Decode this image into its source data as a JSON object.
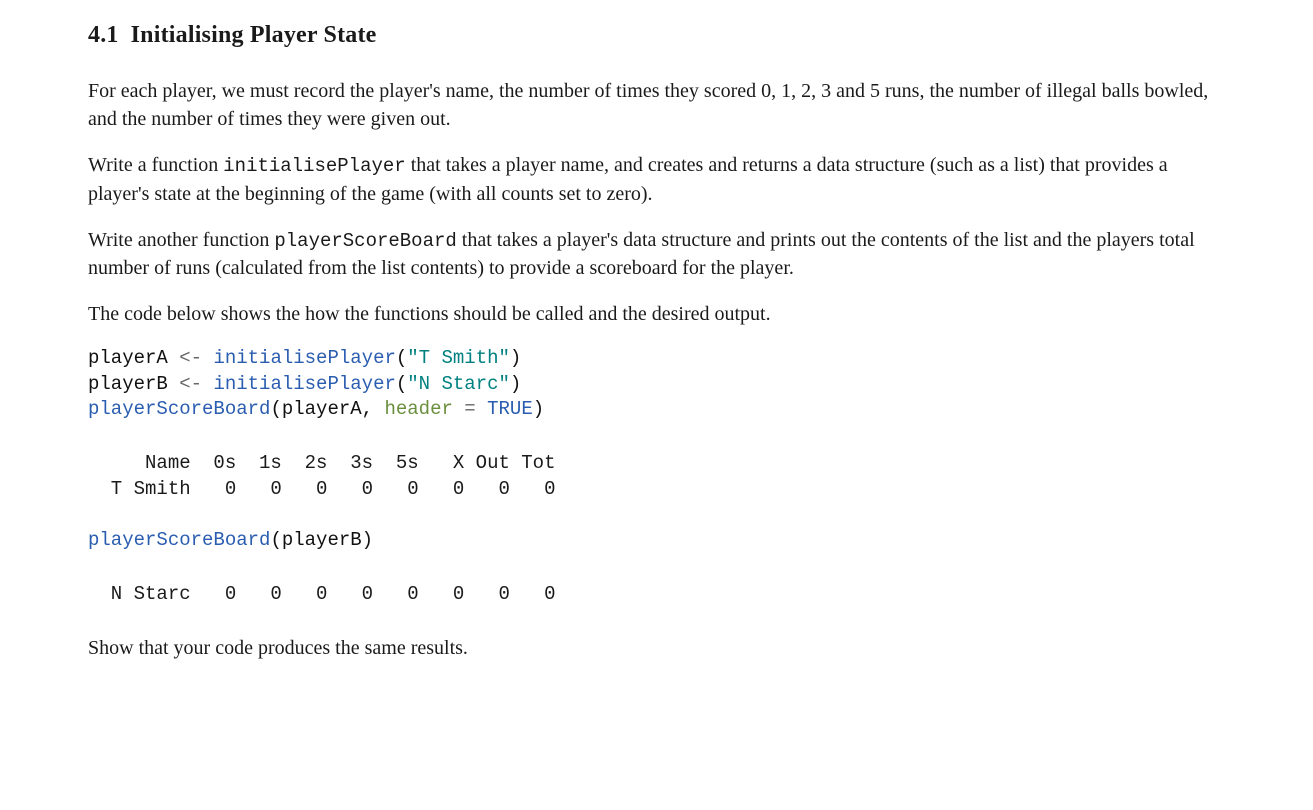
{
  "section": {
    "number": "4.1",
    "title": "Initialising Player State"
  },
  "paragraphs": {
    "p1": "For each player, we must record the player's name, the number of times they scored 0, 1, 2, 3 and 5 runs, the number of illegal balls bowled, and the number of times they were given out.",
    "p2a": "Write a function ",
    "p2_code": "initialisePlayer",
    "p2b": " that takes a player name, and creates and returns a data structure (such as a list) that provides a player's state at the beginning of the game (with all counts set to zero).",
    "p3a": "Write another function ",
    "p3_code": "playerScoreBoard",
    "p3b": " that takes a player's data structure and prints out the contents of the list and the players total number of runs (calculated from the list contents) to provide a scoreboard for the player.",
    "p4": "The code below shows the how the functions should be called and the desired output.",
    "p5": "Show that your code produces the same results."
  },
  "code1": {
    "l1": {
      "ident": "playerA ",
      "op": "<- ",
      "fn": "initialisePlayer",
      "paren_open": "(",
      "str": "\"T Smith\"",
      "paren_close": ")"
    },
    "l2": {
      "ident": "playerB ",
      "op": "<- ",
      "fn": "initialisePlayer",
      "paren_open": "(",
      "str": "\"N Starc\"",
      "paren_close": ")"
    },
    "l3": {
      "fn": "playerScoreBoard",
      "paren_open": "(",
      "ident": "playerA, ",
      "arg": "header ",
      "eq": "= ",
      "bool": "TRUE",
      "paren_close": ")"
    }
  },
  "output1": "     Name  0s  1s  2s  3s  5s   X Out Tot\n  T Smith   0   0   0   0   0   0   0   0",
  "code2": {
    "l1": {
      "fn": "playerScoreBoard",
      "paren_open": "(",
      "ident": "playerB",
      "paren_close": ")"
    }
  },
  "output2": "  N Starc   0   0   0   0   0   0   0   0"
}
